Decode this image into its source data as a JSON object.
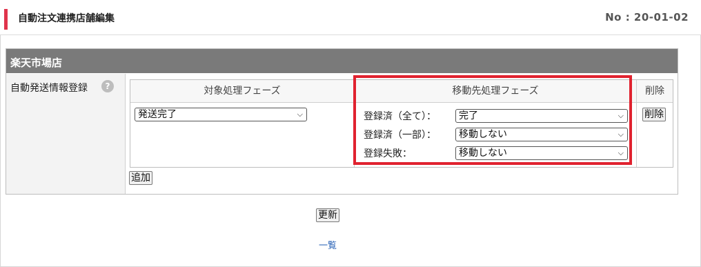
{
  "header": {
    "title": "自動注文連携店舗編集",
    "number": "No : 20-01-02"
  },
  "panel": {
    "store_name": "楽天市場店",
    "row_label": "自動発送情報登録",
    "help_icon": "?",
    "columns": {
      "target_phase": "対象処理フェーズ",
      "move_phase": "移動先処理フェーズ",
      "delete": "削除"
    },
    "target_select_value": "発送完了",
    "move_rows": [
      {
        "label": "登録済（全て）：",
        "value": "完了"
      },
      {
        "label": "登録済（一部）：",
        "value": "移動しない"
      },
      {
        "label": "登録失敗：",
        "value": "移動しない"
      }
    ],
    "delete_button": "削除",
    "add_button": "追加"
  },
  "footer": {
    "update_button": "更新",
    "list_link": "一覧"
  },
  "colors": {
    "accent": "#e0344c",
    "highlight_border": "#e0222f",
    "panel_header": "#7a7a7a",
    "link": "#2a63b6"
  }
}
